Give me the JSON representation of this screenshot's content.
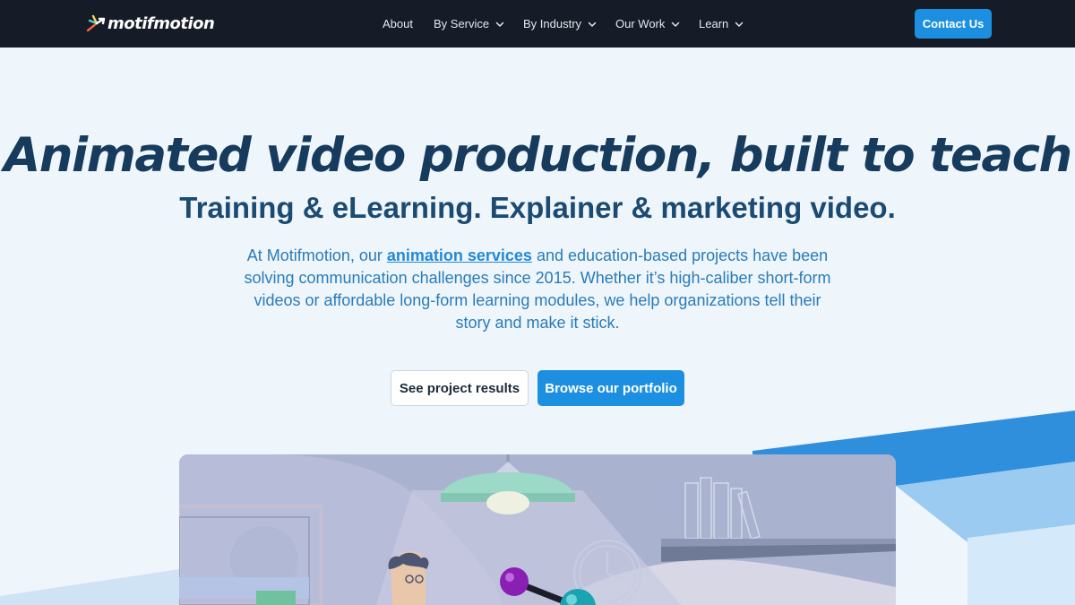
{
  "brand": {
    "name": "motifmotion",
    "colors": {
      "nav_bg": "#161c27",
      "accent": "#1d8fe0",
      "headline": "#173b5c"
    }
  },
  "nav": {
    "items": [
      {
        "label": "About",
        "has_dropdown": false
      },
      {
        "label": "By Service",
        "has_dropdown": true
      },
      {
        "label": "By Industry",
        "has_dropdown": true
      },
      {
        "label": "Our Work",
        "has_dropdown": true
      },
      {
        "label": "Learn",
        "has_dropdown": true
      }
    ],
    "dropdown_icon": "chevron-down-icon",
    "cta": "Contact Us"
  },
  "hero": {
    "headline": "Animated video production, built to teach",
    "subheadline": "Training & eLearning. Explainer & marketing video.",
    "intro_before": "At Motifmotion, our ",
    "intro_link": "animation services",
    "intro_after": " and education-based projects have been solving communication challenges since 2015. Whether it’s high-caliber short-form videos or affordable long-form learning modules, we help organizations tell their story and make it stick.",
    "secondary_button": "See project results",
    "primary_button": "Browse our portfolio"
  },
  "video": {
    "scene_icons": [
      "lamp-icon",
      "bookshelf-icon",
      "clock-icon",
      "character-icon",
      "molecule-icon"
    ]
  }
}
